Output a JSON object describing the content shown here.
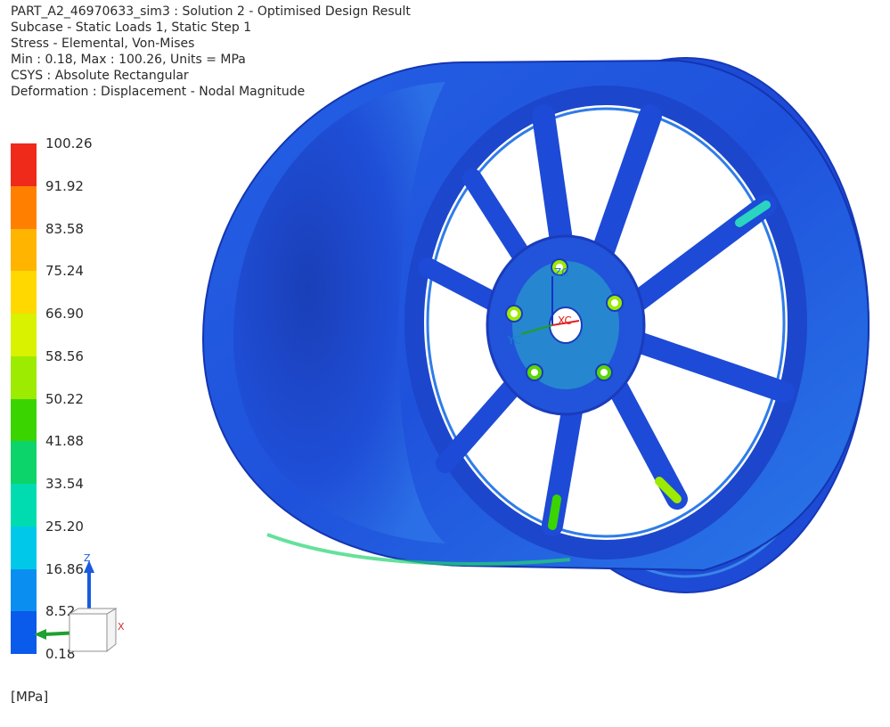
{
  "header": {
    "line1": "PART_A2_46970633_sim3 : Solution 2 - Optimised Design Result",
    "line2": "Subcase - Static Loads 1, Static Step 1",
    "line3": "Stress - Elemental, Von-Mises",
    "line4": "Min : 0.18, Max : 100.26, Units = MPa",
    "line5": "CSYS : Absolute Rectangular",
    "line6": "Deformation : Displacement - Nodal Magnitude"
  },
  "legend": {
    "ticks": [
      "100.26",
      "91.92",
      "83.58",
      "75.24",
      "66.90",
      "58.56",
      "50.22",
      "41.88",
      "33.54",
      "25.20",
      "16.86",
      "8.52",
      "0.18"
    ],
    "colors": [
      "#ef2a1a",
      "#ff7f00",
      "#ffb400",
      "#ffd800",
      "#d8f200",
      "#9ceb00",
      "#3ad400",
      "#0dd46a",
      "#00dcb0",
      "#00c8e8",
      "#0a8ff0",
      "#0a5aeb",
      "#1414e8"
    ],
    "unit": "[MPa]"
  },
  "model": {
    "csys_labels": {
      "xc": "XC",
      "yc": "YC",
      "zc": "ZC"
    },
    "colors": {
      "base": "#1f4fe0",
      "dark": "#1232b0",
      "light": "#2c8ce8",
      "hot": "#22d470"
    }
  },
  "triad": {
    "z_label": "Z",
    "x_label": "X"
  }
}
